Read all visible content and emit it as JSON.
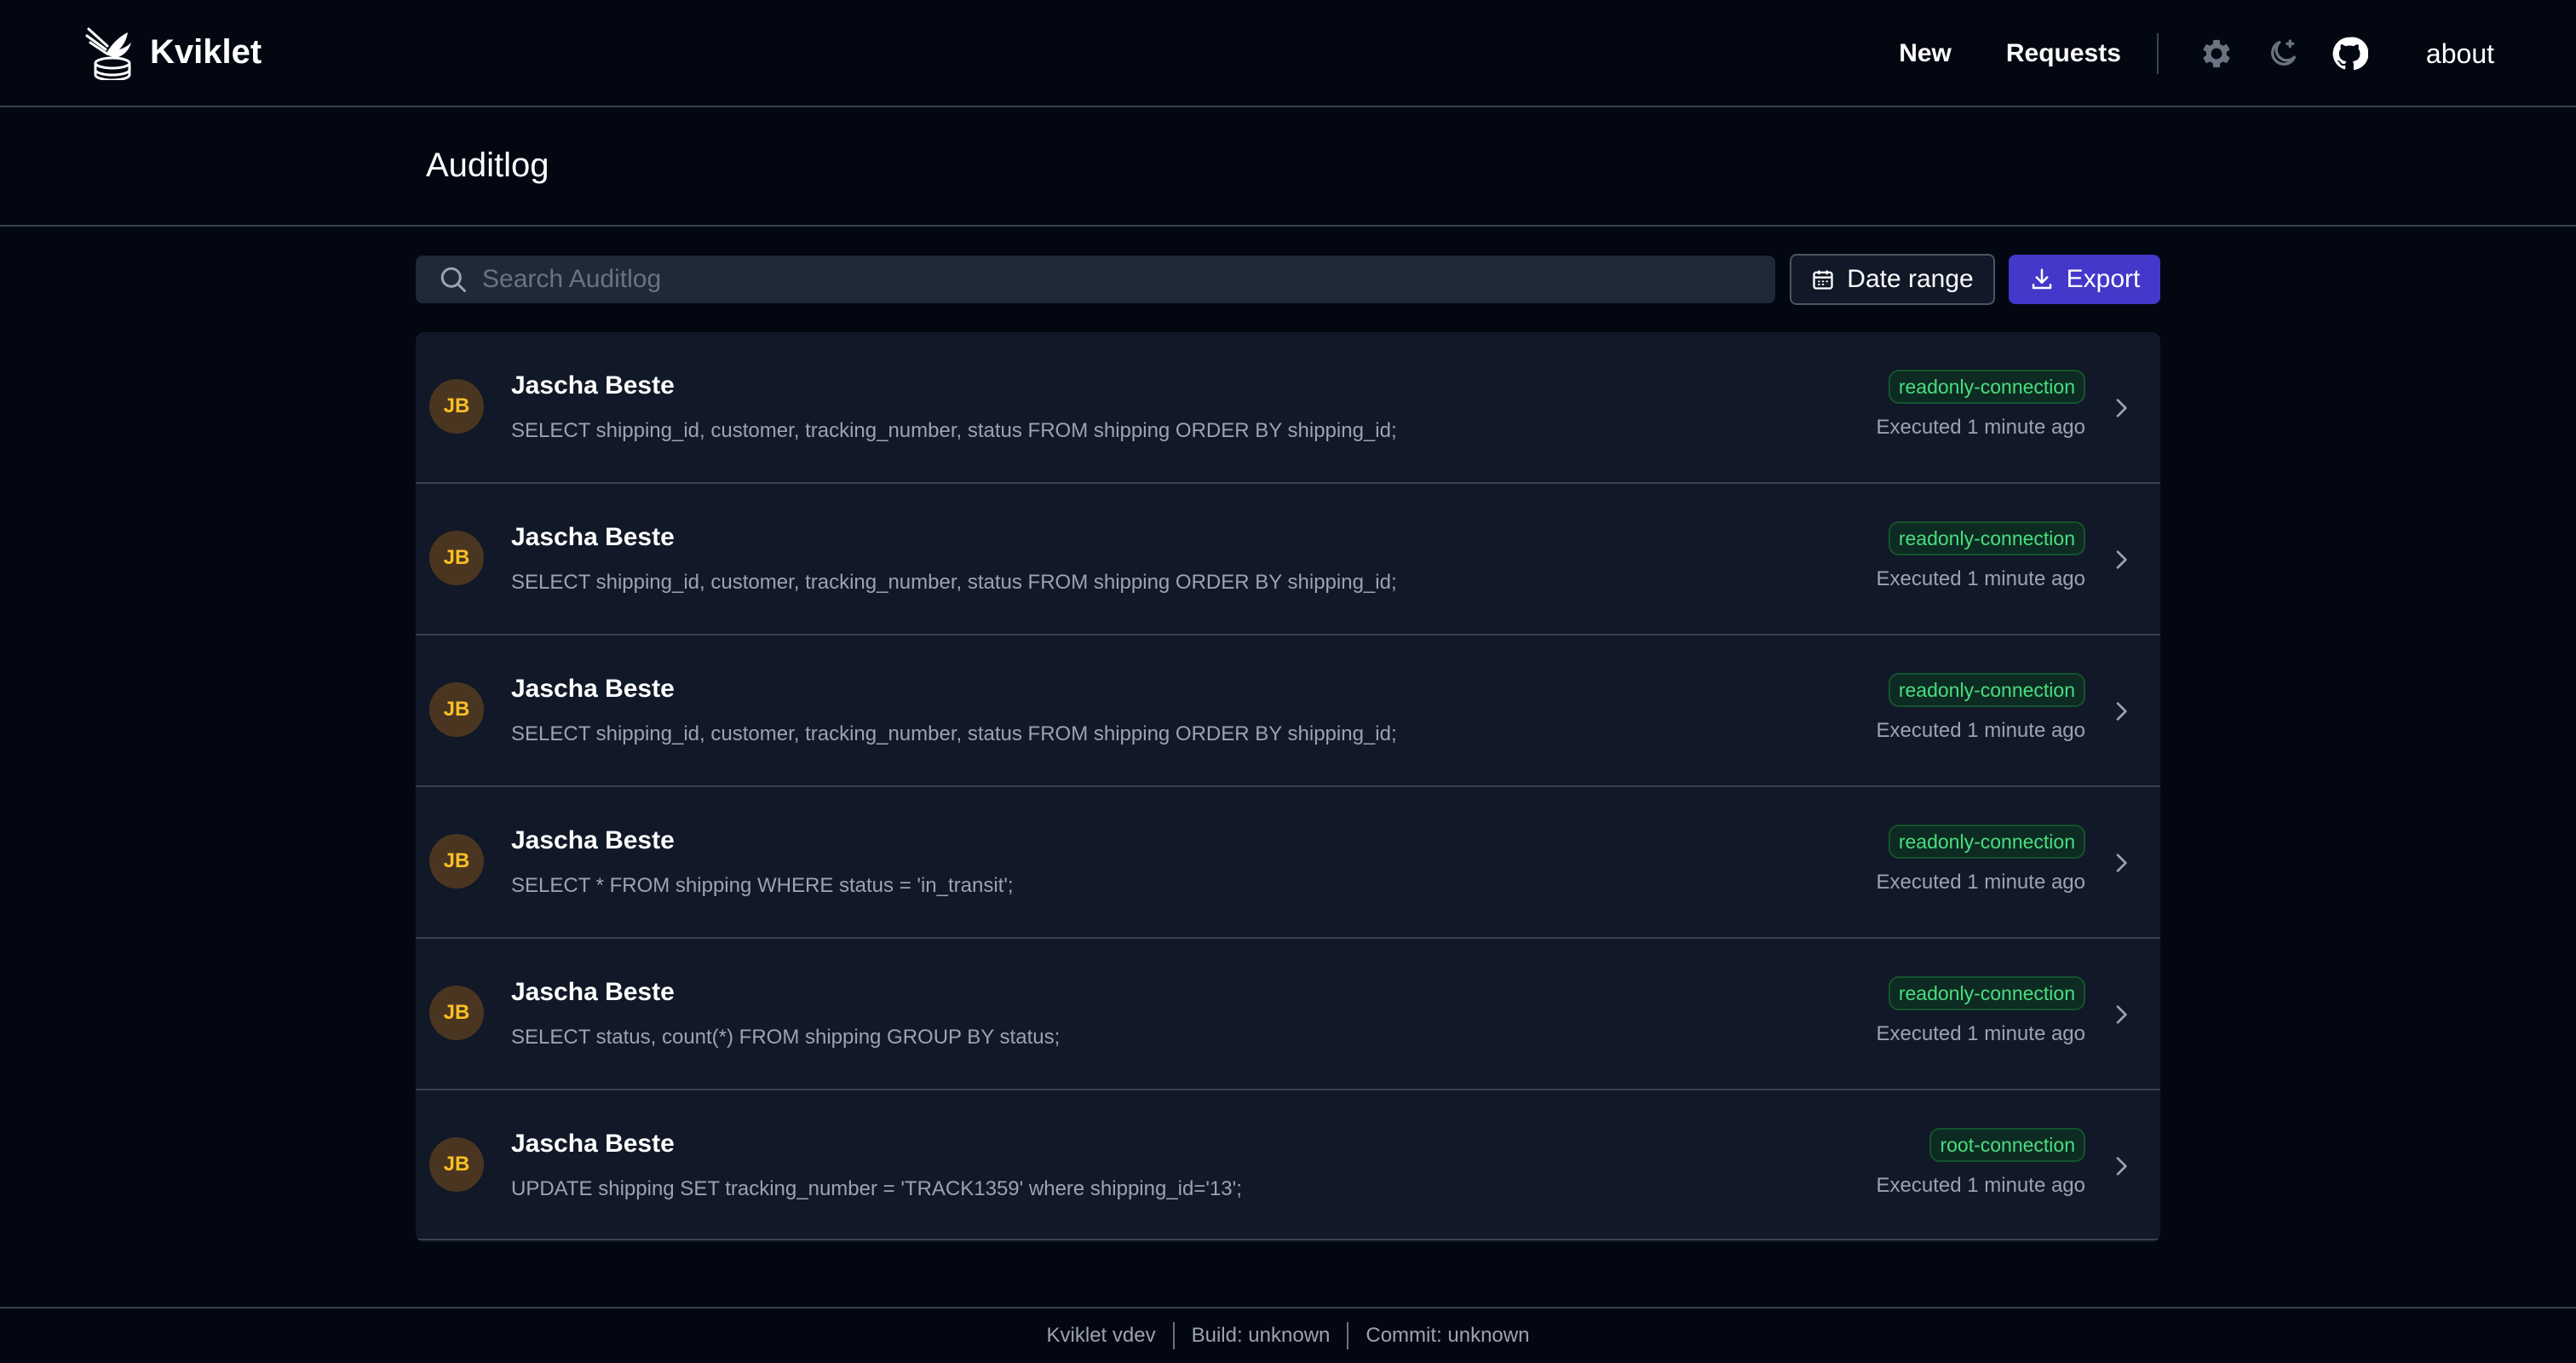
{
  "brand": {
    "name": "Kviklet"
  },
  "nav": {
    "new_label": "New",
    "requests_label": "Requests",
    "about_label": "about",
    "icons": [
      "gear-icon",
      "moon-icon",
      "github-icon"
    ]
  },
  "page": {
    "title": "Auditlog"
  },
  "toolbar": {
    "search_placeholder": "Search Auditlog",
    "search_value": "",
    "date_range_label": "Date range",
    "export_label": "Export"
  },
  "colors": {
    "background": "#030712",
    "surface": "#111827",
    "accent": "#4338ca",
    "badge_text": "#4ade80",
    "avatar_text": "#fbbf24"
  },
  "log": {
    "items": [
      {
        "initials": "JB",
        "user": "Jascha Beste",
        "query": "SELECT shipping_id, customer, tracking_number, status FROM shipping ORDER BY shipping_id;",
        "connection": "readonly-connection",
        "executed": "Executed 1 minute ago"
      },
      {
        "initials": "JB",
        "user": "Jascha Beste",
        "query": "SELECT shipping_id, customer, tracking_number, status FROM shipping ORDER BY shipping_id;",
        "connection": "readonly-connection",
        "executed": "Executed 1 minute ago"
      },
      {
        "initials": "JB",
        "user": "Jascha Beste",
        "query": "SELECT shipping_id, customer, tracking_number, status FROM shipping ORDER BY shipping_id;",
        "connection": "readonly-connection",
        "executed": "Executed 1 minute ago"
      },
      {
        "initials": "JB",
        "user": "Jascha Beste",
        "query": "SELECT * FROM shipping WHERE status = 'in_transit';",
        "connection": "readonly-connection",
        "executed": "Executed 1 minute ago"
      },
      {
        "initials": "JB",
        "user": "Jascha Beste",
        "query": "SELECT status, count(*) FROM shipping GROUP BY status;",
        "connection": "readonly-connection",
        "executed": "Executed 1 minute ago"
      },
      {
        "initials": "JB",
        "user": "Jascha Beste",
        "query": "UPDATE shipping SET tracking_number = 'TRACK1359' where shipping_id='13';",
        "connection": "root-connection",
        "executed": "Executed 1 minute ago"
      }
    ]
  },
  "footer": {
    "version": "Kviklet vdev",
    "build": "Build: unknown",
    "commit": "Commit: unknown"
  }
}
